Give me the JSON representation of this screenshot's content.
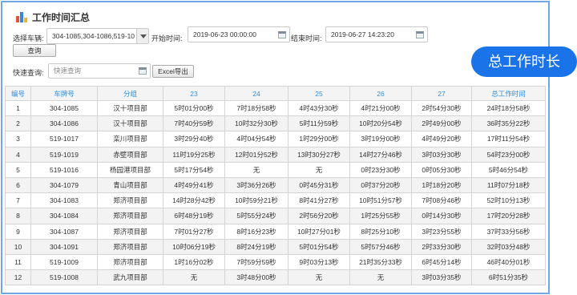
{
  "page": {
    "title": "工作时间汇总"
  },
  "filters": {
    "vehicle_label": "选择车辆:",
    "vehicle_value": "304-1085,304-1086,519-10",
    "start_label": "开始时间:",
    "start_value": "2019-06-23 00:00:00",
    "end_label": "结束时间:",
    "end_value": "2019-06-27 14:23:20",
    "query_button": "查询",
    "quick_label": "快速查询:",
    "quick_placeholder": "快速查询",
    "excel_button": "Excel导出"
  },
  "badge": {
    "text": "总工作时长"
  },
  "table": {
    "headers": [
      "编号",
      "车牌号",
      "分组",
      "23",
      "24",
      "25",
      "26",
      "27",
      "总工作时间"
    ],
    "rows": [
      [
        "1",
        "304-1085",
        "汉十项目部",
        "5时01分00秒",
        "7时18分58秒",
        "4时43分30秒",
        "4时21分00秒",
        "2时54分30秒",
        "24时18分58秒"
      ],
      [
        "2",
        "304-1086",
        "汉十项目部",
        "7时40分59秒",
        "10时32分30秒",
        "5时11分59秒",
        "10时20分54秒",
        "2时49分00秒",
        "36时35分22秒"
      ],
      [
        "3",
        "519-1017",
        "栾川项目部",
        "3时29分40秒",
        "4时04分54秒",
        "1时29分00秒",
        "3时19分00秒",
        "4时49分20秒",
        "17时11分54秒"
      ],
      [
        "4",
        "519-1019",
        "赤壁项目部",
        "11时19分25秒",
        "12时01分52秒",
        "13时30分27秒",
        "14时27分46秒",
        "3时03分30秒",
        "54时23分00秒"
      ],
      [
        "5",
        "519-1016",
        "杨园港项目部",
        "5时17分54秒",
        "无",
        "无",
        "0时23分30秒",
        "0时05分30秒",
        "5时46分54秒"
      ],
      [
        "6",
        "304-1079",
        "青山项目部",
        "4时49分41秒",
        "3时36分26秒",
        "0时45分31秒",
        "0时37分20秒",
        "1时18分20秒",
        "11时07分18秒"
      ],
      [
        "7",
        "304-1083",
        "郑济项目部",
        "14时28分42秒",
        "10时59分21秒",
        "8时41分27秒",
        "10时51分57秒",
        "7时08分46秒",
        "52时10分13秒"
      ],
      [
        "8",
        "304-1084",
        "郑济项目部",
        "6时48分19秒",
        "5时55分24秒",
        "2时56分20秒",
        "1时25分55秒",
        "0时14分30秒",
        "17时20分28秒"
      ],
      [
        "9",
        "304-1087",
        "郑济项目部",
        "7时01分27秒",
        "8时16分23秒",
        "10时27分01秒",
        "8时25分10秒",
        "3时23分55秒",
        "37时33分56秒"
      ],
      [
        "10",
        "304-1091",
        "郑济项目部",
        "10时06分19秒",
        "8时24分19秒",
        "5时01分54秒",
        "5时57分46秒",
        "2时33分30秒",
        "32时03分48秒"
      ],
      [
        "11",
        "519-1009",
        "郑济项目部",
        "1时16分02秒",
        "7时59分59秒",
        "9时03分13秒",
        "21时35分33秒",
        "6时45分14秒",
        "46时40分01秒"
      ],
      [
        "12",
        "519-1008",
        "武九项目部",
        "无",
        "3时48分00秒",
        "无",
        "无",
        "3时03分35秒",
        "6时51分35秒"
      ]
    ]
  }
}
